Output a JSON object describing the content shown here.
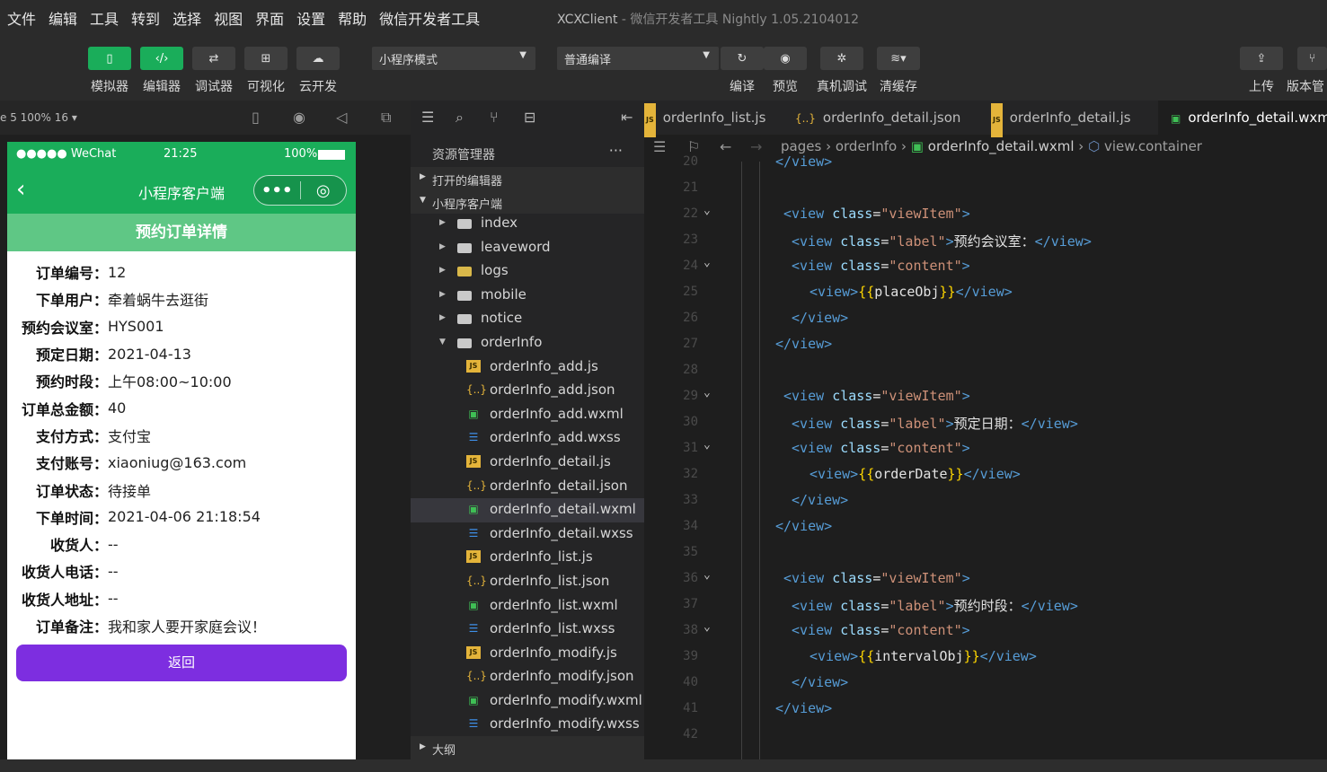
{
  "menubar": {
    "items": [
      "文件",
      "编辑",
      "工具",
      "转到",
      "选择",
      "视图",
      "界面",
      "设置",
      "帮助",
      "微信开发者工具"
    ],
    "app_title": "XCXClient",
    "app_subtitle": "- 微信开发者工具 Nightly 1.05.2104012"
  },
  "toolbar": {
    "left_buttons": [
      {
        "label": "模拟器",
        "icon": "phone-icon"
      },
      {
        "label": "编辑器",
        "icon": "code-icon"
      },
      {
        "label": "调试器",
        "icon": "debug-icon"
      },
      {
        "label": "可视化",
        "icon": "layout-icon"
      },
      {
        "label": "云开发",
        "icon": "cloud-icon"
      }
    ],
    "mode_select": "小程序模式",
    "compile_select": "普通编译",
    "right_buttons": [
      {
        "label": "编译",
        "icon": "refresh-icon"
      },
      {
        "label": "预览",
        "icon": "eye-icon"
      },
      {
        "label": "真机调试",
        "icon": "bug-icon"
      },
      {
        "label": "清缓存",
        "icon": "layers-icon"
      }
    ],
    "far_right": [
      {
        "label": "上传",
        "icon": "upload-icon"
      },
      {
        "label": "版本管",
        "icon": "branch-icon"
      }
    ]
  },
  "subbar": {
    "device": "e 5 100% 16 ▾"
  },
  "phone": {
    "status_carrier": "●●●●● WeChat",
    "status_time": "21:25",
    "status_battery": "100%",
    "nav_title": "小程序客户端",
    "page_header": "预约订单详情",
    "fields": [
      {
        "label": "订单编号：",
        "value": "12"
      },
      {
        "label": "下单用户：",
        "value": "牵着蜗牛去逛街"
      },
      {
        "label": "预约会议室：",
        "value": "HYS001"
      },
      {
        "label": "预定日期：",
        "value": "2021-04-13"
      },
      {
        "label": "预约时段：",
        "value": "上午08:00~10:00"
      },
      {
        "label": "订单总金额：",
        "value": "40"
      },
      {
        "label": "支付方式：",
        "value": "支付宝"
      },
      {
        "label": "支付账号：",
        "value": "xiaoniug@163.com"
      },
      {
        "label": "订单状态：",
        "value": "待接单"
      },
      {
        "label": "下单时间：",
        "value": "2021-04-06 21:18:54"
      },
      {
        "label": "收货人：",
        "value": "--"
      },
      {
        "label": "收货人电话：",
        "value": "--"
      },
      {
        "label": "收货人地址：",
        "value": "--"
      },
      {
        "label": "订单备注：",
        "value": "我和家人要开家庭会议！"
      }
    ],
    "return_button": "返回"
  },
  "explorer": {
    "title": "资源管理器",
    "more": "···",
    "open_editors": "打开的编辑器",
    "project": "小程序客户端",
    "outline": "大纲",
    "tree": [
      {
        "name": "index",
        "type": "folder",
        "depth": 1,
        "expanded": false
      },
      {
        "name": "leaveword",
        "type": "folder",
        "depth": 1,
        "expanded": false
      },
      {
        "name": "logs",
        "type": "folder-special",
        "depth": 1,
        "expanded": false
      },
      {
        "name": "mobile",
        "type": "folder",
        "depth": 1,
        "expanded": false
      },
      {
        "name": "notice",
        "type": "folder",
        "depth": 1,
        "expanded": false
      },
      {
        "name": "orderInfo",
        "type": "folder-open",
        "depth": 1,
        "expanded": true
      },
      {
        "name": "orderInfo_add.js",
        "type": "js",
        "depth": 2
      },
      {
        "name": "orderInfo_add.json",
        "type": "json",
        "depth": 2
      },
      {
        "name": "orderInfo_add.wxml",
        "type": "wxml",
        "depth": 2
      },
      {
        "name": "orderInfo_add.wxss",
        "type": "wxss",
        "depth": 2
      },
      {
        "name": "orderInfo_detail.js",
        "type": "js",
        "depth": 2
      },
      {
        "name": "orderInfo_detail.json",
        "type": "json",
        "depth": 2
      },
      {
        "name": "orderInfo_detail.wxml",
        "type": "wxml",
        "depth": 2,
        "selected": true
      },
      {
        "name": "orderInfo_detail.wxss",
        "type": "wxss",
        "depth": 2
      },
      {
        "name": "orderInfo_list.js",
        "type": "js",
        "depth": 2
      },
      {
        "name": "orderInfo_list.json",
        "type": "json",
        "depth": 2
      },
      {
        "name": "orderInfo_list.wxml",
        "type": "wxml",
        "depth": 2
      },
      {
        "name": "orderInfo_list.wxss",
        "type": "wxss",
        "depth": 2
      },
      {
        "name": "orderInfo_modify.js",
        "type": "js",
        "depth": 2
      },
      {
        "name": "orderInfo_modify.json",
        "type": "json",
        "depth": 2
      },
      {
        "name": "orderInfo_modify.wxml",
        "type": "wxml",
        "depth": 2
      },
      {
        "name": "orderInfo_modify.wxss",
        "type": "wxss",
        "depth": 2
      }
    ]
  },
  "editor": {
    "tabs": [
      {
        "label": "orderInfo_list.js",
        "type": "js"
      },
      {
        "label": "orderInfo_detail.json",
        "type": "json"
      },
      {
        "label": "orderInfo_detail.js",
        "type": "js"
      },
      {
        "label": "orderInfo_detail.wxml",
        "type": "wxml",
        "active": true
      }
    ],
    "breadcrumb": {
      "p1": "pages",
      "p2": "orderInfo",
      "p3": "orderInfo_detail.wxml",
      "p4": "view.container"
    },
    "lines": [
      {
        "n": "20",
        "indent": 0,
        "parts": [
          [
            "tag",
            "</view>"
          ]
        ]
      },
      {
        "n": "21",
        "indent": 0,
        "parts": []
      },
      {
        "n": "22",
        "indent": 1,
        "fold": true,
        "parts": [
          [
            "tag",
            "<view "
          ],
          [
            "attr",
            "class"
          ],
          [
            "txt",
            "="
          ],
          [
            "str",
            "\"viewItem\""
          ],
          [
            "tag",
            ">"
          ]
        ]
      },
      {
        "n": "23",
        "indent": 2,
        "parts": [
          [
            "tag",
            "<view "
          ],
          [
            "attr",
            "class"
          ],
          [
            "txt",
            "="
          ],
          [
            "str",
            "\"label\""
          ],
          [
            "tag",
            ">"
          ],
          [
            "txt",
            "预约会议室："
          ],
          [
            "tag",
            "</view>"
          ]
        ]
      },
      {
        "n": "24",
        "indent": 2,
        "fold": true,
        "parts": [
          [
            "tag",
            "<view "
          ],
          [
            "attr",
            "class"
          ],
          [
            "txt",
            "="
          ],
          [
            "str",
            "\"content\""
          ],
          [
            "tag",
            ">"
          ]
        ]
      },
      {
        "n": "25",
        "indent": 3,
        "parts": [
          [
            "tag",
            "<view>"
          ],
          [
            "br",
            "{{"
          ],
          [
            "txt",
            "placeObj"
          ],
          [
            "br",
            "}}"
          ],
          [
            "tag",
            "</view>"
          ]
        ]
      },
      {
        "n": "26",
        "indent": 2,
        "parts": [
          [
            "tag",
            "</view>"
          ]
        ]
      },
      {
        "n": "27",
        "indent": 0,
        "parts": [
          [
            "tag",
            "</view>"
          ]
        ]
      },
      {
        "n": "28",
        "indent": 0,
        "parts": []
      },
      {
        "n": "29",
        "indent": 1,
        "fold": true,
        "parts": [
          [
            "tag",
            "<view "
          ],
          [
            "attr",
            "class"
          ],
          [
            "txt",
            "="
          ],
          [
            "str",
            "\"viewItem\""
          ],
          [
            "tag",
            ">"
          ]
        ]
      },
      {
        "n": "30",
        "indent": 2,
        "parts": [
          [
            "tag",
            "<view "
          ],
          [
            "attr",
            "class"
          ],
          [
            "txt",
            "="
          ],
          [
            "str",
            "\"label\""
          ],
          [
            "tag",
            ">"
          ],
          [
            "txt",
            "预定日期："
          ],
          [
            "tag",
            "</view>"
          ]
        ]
      },
      {
        "n": "31",
        "indent": 2,
        "fold": true,
        "parts": [
          [
            "tag",
            "<view "
          ],
          [
            "attr",
            "class"
          ],
          [
            "txt",
            "="
          ],
          [
            "str",
            "\"content\""
          ],
          [
            "tag",
            ">"
          ]
        ]
      },
      {
        "n": "32",
        "indent": 3,
        "parts": [
          [
            "tag",
            "<view>"
          ],
          [
            "br",
            "{{"
          ],
          [
            "txt",
            "orderDate"
          ],
          [
            "br",
            "}}"
          ],
          [
            "tag",
            "</view>"
          ]
        ]
      },
      {
        "n": "33",
        "indent": 2,
        "parts": [
          [
            "tag",
            "</view>"
          ]
        ]
      },
      {
        "n": "34",
        "indent": 0,
        "parts": [
          [
            "tag",
            "</view>"
          ]
        ]
      },
      {
        "n": "35",
        "indent": 0,
        "parts": []
      },
      {
        "n": "36",
        "indent": 1,
        "fold": true,
        "parts": [
          [
            "tag",
            "<view "
          ],
          [
            "attr",
            "class"
          ],
          [
            "txt",
            "="
          ],
          [
            "str",
            "\"viewItem\""
          ],
          [
            "tag",
            ">"
          ]
        ]
      },
      {
        "n": "37",
        "indent": 2,
        "parts": [
          [
            "tag",
            "<view "
          ],
          [
            "attr",
            "class"
          ],
          [
            "txt",
            "="
          ],
          [
            "str",
            "\"label\""
          ],
          [
            "tag",
            ">"
          ],
          [
            "txt",
            "预约时段："
          ],
          [
            "tag",
            "</view>"
          ]
        ]
      },
      {
        "n": "38",
        "indent": 2,
        "fold": true,
        "parts": [
          [
            "tag",
            "<view "
          ],
          [
            "attr",
            "class"
          ],
          [
            "txt",
            "="
          ],
          [
            "str",
            "\"content\""
          ],
          [
            "tag",
            ">"
          ]
        ]
      },
      {
        "n": "39",
        "indent": 3,
        "parts": [
          [
            "tag",
            "<view>"
          ],
          [
            "br",
            "{{"
          ],
          [
            "txt",
            "intervalObj"
          ],
          [
            "br",
            "}}"
          ],
          [
            "tag",
            "</view>"
          ]
        ]
      },
      {
        "n": "40",
        "indent": 2,
        "parts": [
          [
            "tag",
            "</view>"
          ]
        ]
      },
      {
        "n": "41",
        "indent": 0,
        "parts": [
          [
            "tag",
            "</view>"
          ]
        ]
      },
      {
        "n": "42",
        "indent": 0,
        "parts": []
      }
    ]
  }
}
